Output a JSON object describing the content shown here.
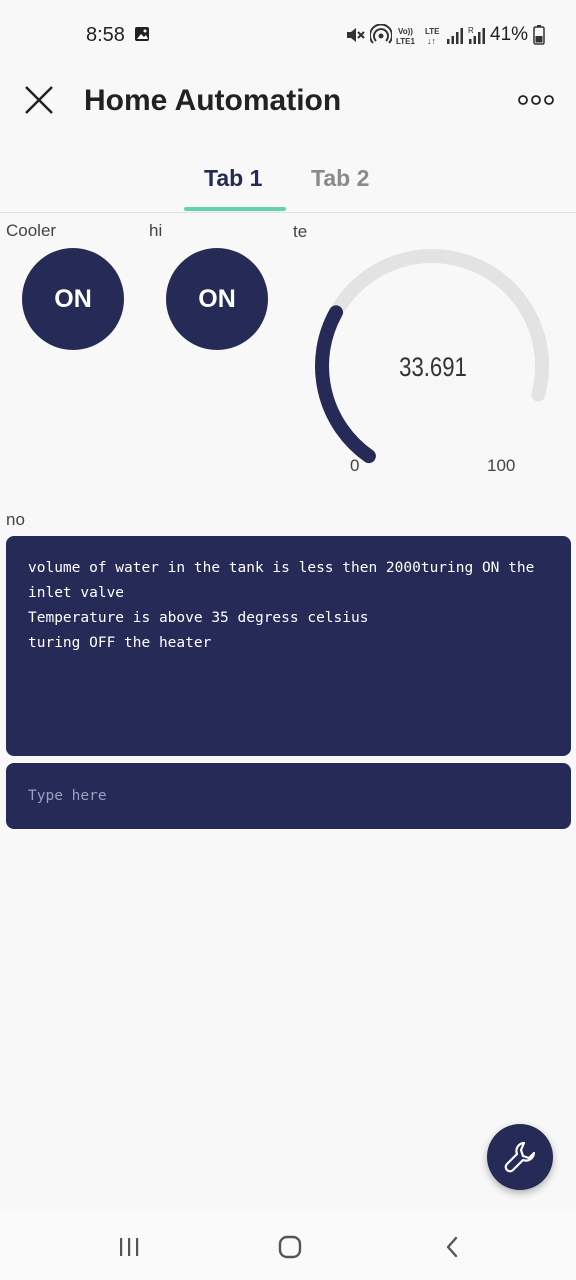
{
  "status_bar": {
    "time": "8:58",
    "battery": "41%",
    "icons": [
      "gallery-icon",
      "mute-icon",
      "hotspot-icon",
      "volte-icon",
      "lte-icon",
      "signal-icon",
      "signal-roaming-icon",
      "battery-icon"
    ]
  },
  "app": {
    "title": "Home Automation"
  },
  "tabs": [
    {
      "label": "Tab 1",
      "active": true
    },
    {
      "label": "Tab 2",
      "active": false
    }
  ],
  "widgets": {
    "cooler": {
      "label": "Cooler",
      "button_text": "ON"
    },
    "hi": {
      "label": "hi",
      "button_text": "ON"
    },
    "gauge": {
      "label": "te",
      "value": "33.691",
      "min": "0",
      "max": "100",
      "fill_fraction": 0.337
    },
    "terminal": {
      "label": "no",
      "lines": [
        "volume of water in the tank is less then 2000turing ON the inlet valve",
        "Temperature is above 35 degress celsius",
        "turing OFF the heater"
      ],
      "input_placeholder": "Type here"
    }
  },
  "colors": {
    "primary": "#262a57",
    "accent": "#63d2b0",
    "gauge_track": "#e3e3e3"
  },
  "nav": [
    "recent-apps-icon",
    "home-icon",
    "back-icon"
  ]
}
